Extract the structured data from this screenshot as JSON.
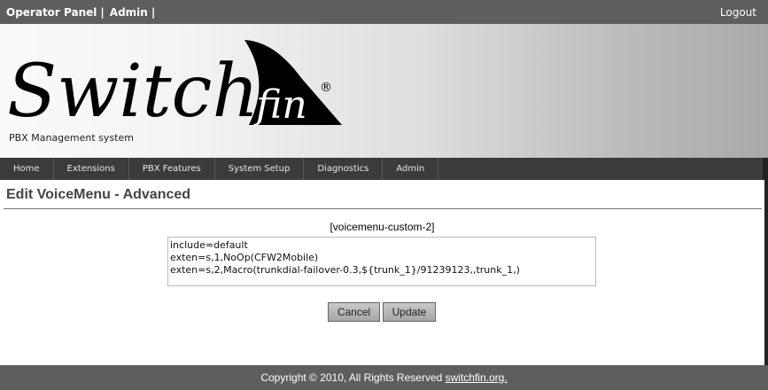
{
  "topbar": {
    "operator_panel": "Operator Panel",
    "admin": "Admin",
    "separator": "|",
    "logout": "Logout"
  },
  "banner": {
    "logo_text_main": "Switch",
    "logo_text_fin": "fin",
    "logo_registered": "®",
    "tagline": "PBX Management system"
  },
  "nav": {
    "items": [
      "Home",
      "Extensions",
      "PBX Features",
      "System Setup",
      "Diagnostics",
      "Admin"
    ]
  },
  "page": {
    "title": "Edit VoiceMenu - Advanced",
    "section_label": "[voicemenu-custom-2]",
    "config_text": "include=default\nexten=s,1,NoOp(CFW2Mobile)\nexten=s,2,Macro(trunkdial-failover-0.3,${trunk_1}/91239123,,trunk_1,)"
  },
  "buttons": {
    "cancel": "Cancel",
    "update": "Update"
  },
  "footer": {
    "copyright": "Copyright © 2010, All Rights Reserved ",
    "link": "switchfin.org."
  },
  "colors": {
    "topbar_bg": "#5e5e5e",
    "navbar_bg": "#3b3b3b",
    "footer_bg": "#5e5e5e"
  },
  "icons": [
    "switchfin-logo"
  ]
}
